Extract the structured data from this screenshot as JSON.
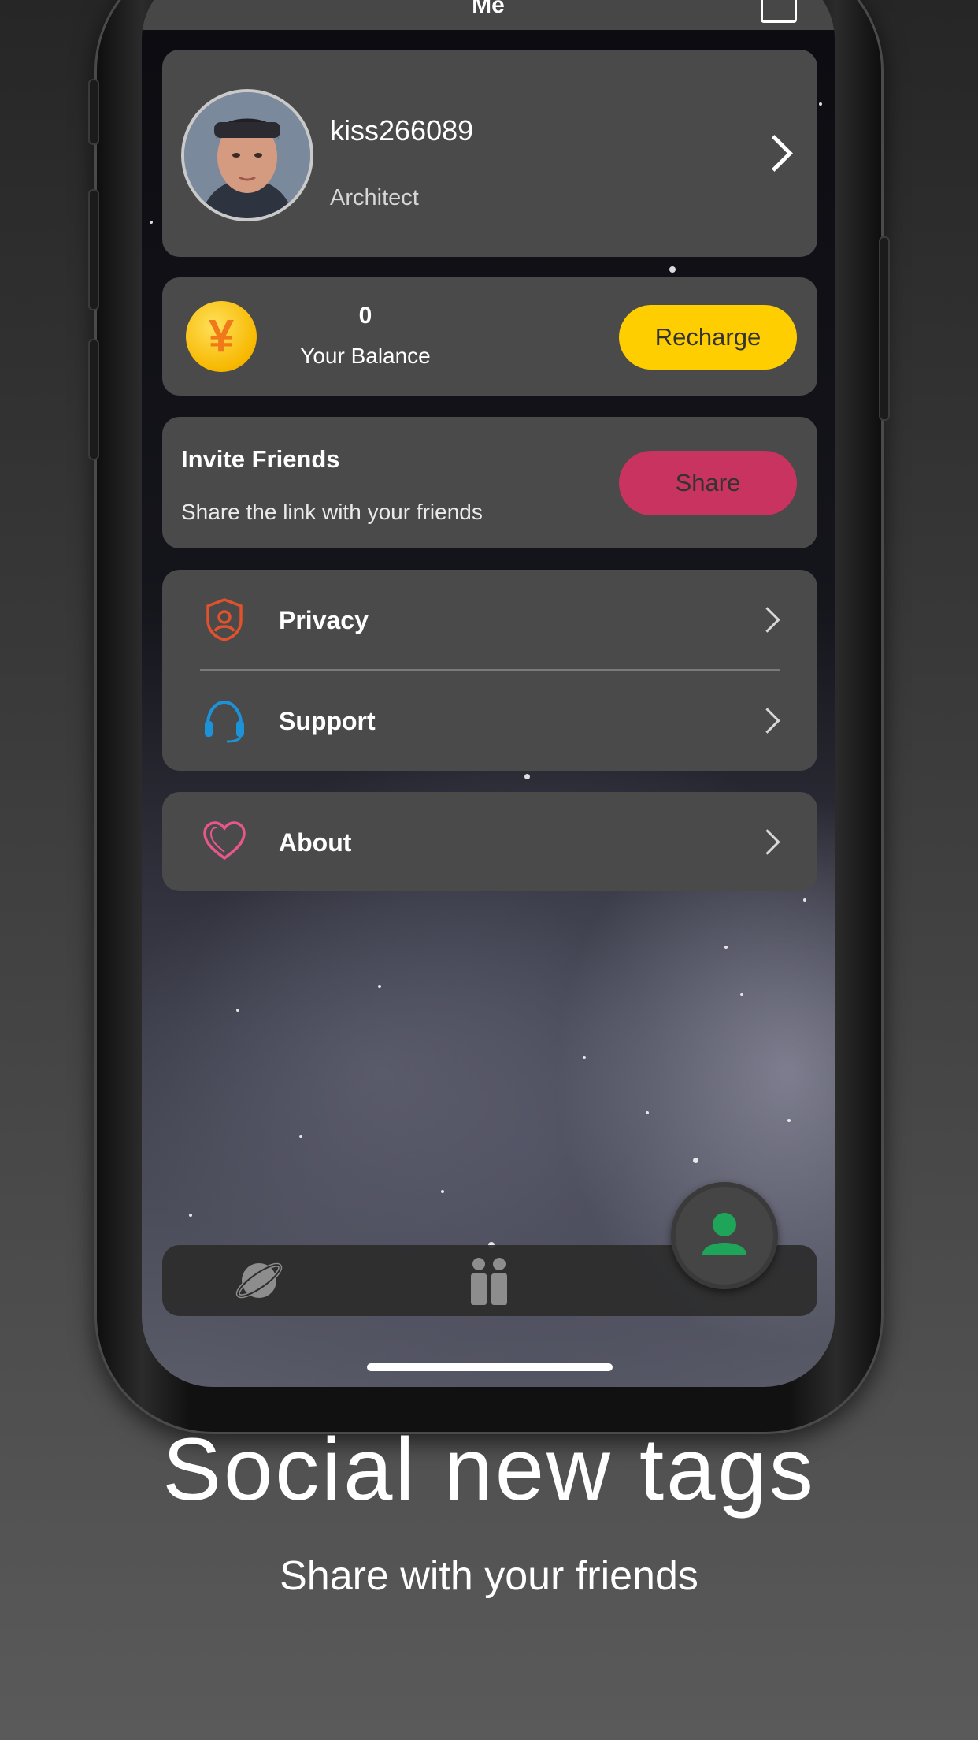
{
  "nav": {
    "title": "Me"
  },
  "profile": {
    "username": "kiss266089",
    "role": "Architect"
  },
  "balance": {
    "coin_symbol": "¥",
    "value": "0",
    "label": "Your Balance",
    "recharge_label": "Recharge"
  },
  "invite": {
    "title": "Invite Friends",
    "subtitle": "Share the link with your friends",
    "share_label": "Share"
  },
  "menu": [
    {
      "label": "Privacy",
      "icon": "shield-user-icon",
      "color": "#e0522b"
    },
    {
      "label": "Support",
      "icon": "headset-icon",
      "color": "#1c93d8"
    },
    {
      "label": "About",
      "icon": "heart-icon",
      "color": "#e8578b"
    }
  ],
  "tabbar": {
    "tabs": [
      "planet-icon",
      "gift-icon",
      "user-icon"
    ],
    "active_color": "#1fa55a"
  },
  "marketing": {
    "headline": "Social new tags",
    "subline": "Share with your friends"
  }
}
